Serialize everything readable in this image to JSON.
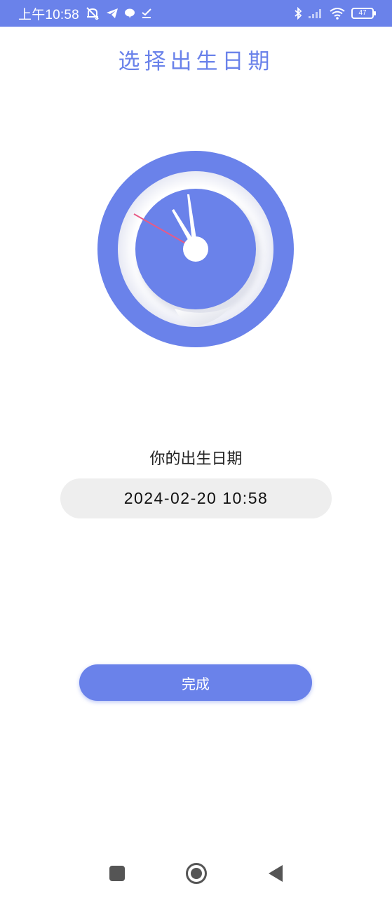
{
  "status_bar": {
    "time": "上午10:58",
    "battery": "47"
  },
  "page_title": "选择出生日期",
  "birth_label": "你的出生日期",
  "birth_datetime": "2024-02-20 10:58",
  "done_button": "完成",
  "colors": {
    "accent": "#6a82ea",
    "field_bg": "#eeeeee",
    "second_hand": "#e85a86"
  },
  "icons": {
    "status_left": [
      "mute-bell-icon",
      "telegram-icon",
      "chat-bubble-icon",
      "download-check-icon"
    ],
    "status_right": [
      "bluetooth-icon",
      "signal-icon",
      "wifi-icon",
      "battery-icon"
    ],
    "nav": [
      "recent-apps-icon",
      "home-icon",
      "back-icon"
    ]
  }
}
